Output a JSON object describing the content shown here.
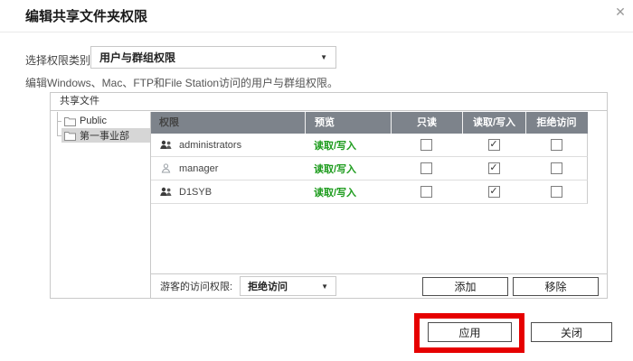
{
  "dialog": {
    "title": "编辑共享文件夹权限"
  },
  "icons": {
    "close": "✕",
    "dropdown_arrow": "▼",
    "check": "✓"
  },
  "permission_type": {
    "label": "选择权限类别:",
    "selected": "用户与群组权限",
    "description": "编辑Windows、Mac、FTP和File Station访问的用户与群组权限。"
  },
  "shared_folders": {
    "panel_title": "共享文件",
    "tree": [
      {
        "label": "Public",
        "selected": false
      },
      {
        "label": "第一事业部",
        "selected": true
      }
    ]
  },
  "permissions_table": {
    "columns": [
      "权限",
      "预览",
      "只读",
      "读取/写入",
      "拒绝访问"
    ],
    "rows": [
      {
        "name": "administrators",
        "icon": "group-icon",
        "preview": "读取/写入",
        "read_only": false,
        "read_write": true,
        "deny_access": false
      },
      {
        "name": "manager",
        "icon": "user-icon",
        "preview": "读取/写入",
        "read_only": false,
        "read_write": true,
        "deny_access": false
      },
      {
        "name": "D1SYB",
        "icon": "group-icon",
        "preview": "读取/写入",
        "read_only": false,
        "read_write": true,
        "deny_access": false
      }
    ]
  },
  "guest_access": {
    "label": "游客的访问权限:",
    "selected": "拒绝访问",
    "add_button": "添加",
    "remove_button": "移除"
  },
  "footer": {
    "apply_button": "应用",
    "close_button": "关闭"
  },
  "colors": {
    "table_header_bg": "#7d838b",
    "permission_green": "#1e9c1e",
    "annotation_red": "#e60000",
    "tree_selected_bg": "#d6d6d6"
  }
}
